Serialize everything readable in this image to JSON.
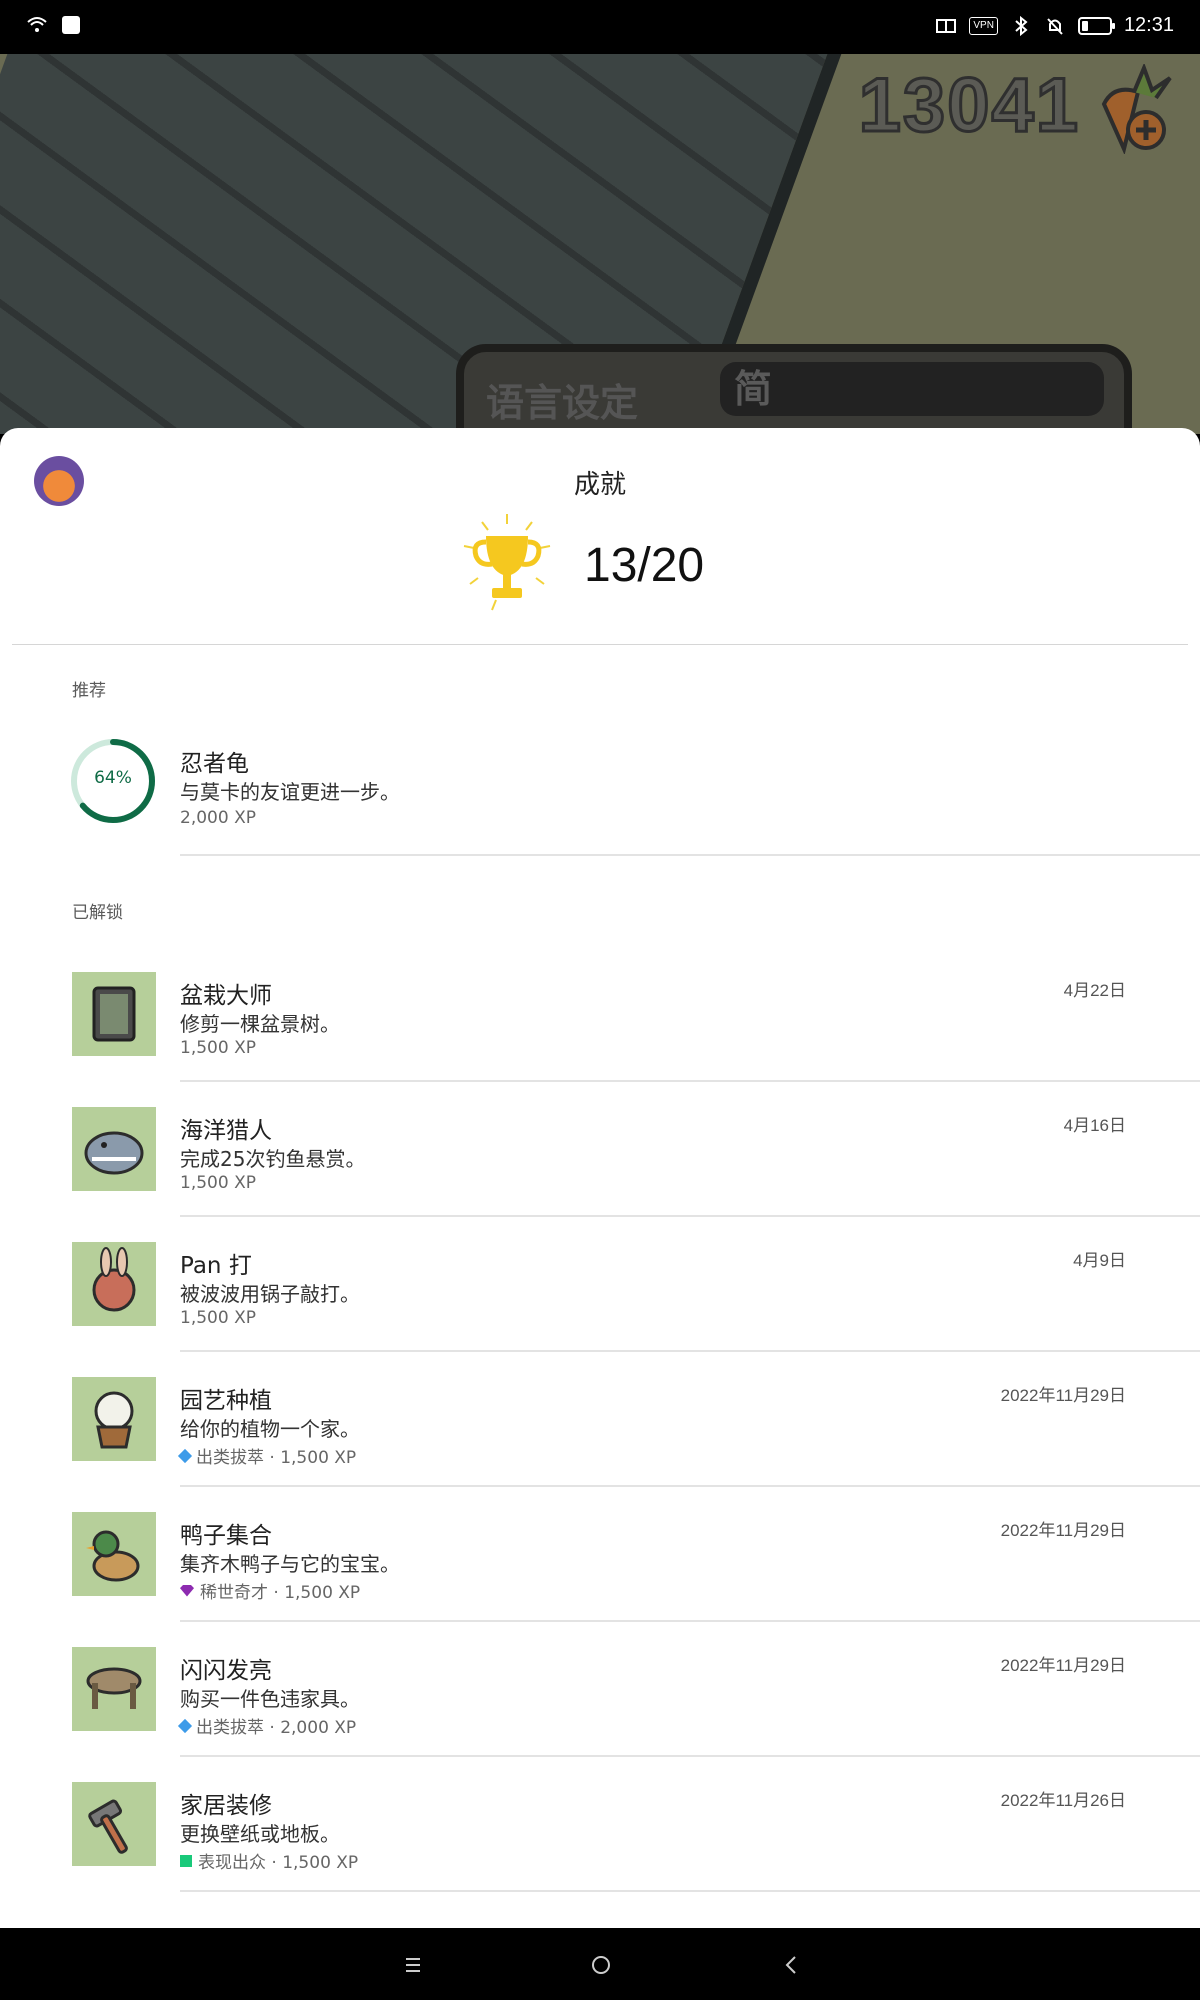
{
  "status_bar": {
    "time": "12:31",
    "vpn": "VPN"
  },
  "game": {
    "carrot_count": "13041",
    "language_label": "语言设定",
    "language_value": "简"
  },
  "sheet": {
    "title": "成就",
    "score": "13/20",
    "recommended_label": "推荐",
    "recommended": {
      "progress_text": "64%",
      "progress": 0.64,
      "title": "忍者龟",
      "desc": "与莫卡的友谊更进一步。",
      "xp": "2,000 XP"
    },
    "unlocked_label": "已解锁",
    "achievements": [
      {
        "title": "盆栽大师",
        "desc": "修剪一棵盆景树。",
        "meta": "1,500 XP",
        "date": "4月22日",
        "rarity": "",
        "icon": "book-icon"
      },
      {
        "title": "海洋猎人",
        "desc": "完成25次钓鱼悬赏。",
        "meta": "1,500 XP",
        "date": "4月16日",
        "rarity": "",
        "icon": "shark-icon"
      },
      {
        "title": "Pan 打",
        "desc": "被波波用锅子敲打。",
        "meta": "1,500 XP",
        "date": "4月9日",
        "rarity": "",
        "icon": "bunny-pan-icon"
      },
      {
        "title": "园艺种植",
        "desc": "给你的植物一个家。",
        "meta": "出类拔萃 · 1,500 XP",
        "date": "2022年11月29日",
        "rarity": "diamond",
        "icon": "flower-pot-icon"
      },
      {
        "title": "鸭子集合",
        "desc": "集齐木鸭子与它的宝宝。",
        "meta": "稀世奇才 · 1,500 XP",
        "date": "2022年11月29日",
        "rarity": "purple",
        "icon": "duck-icon"
      },
      {
        "title": "闪闪发亮",
        "desc": "购买一件色违家具。",
        "meta": "出类拔萃 · 2,000 XP",
        "date": "2022年11月29日",
        "rarity": "diamond",
        "icon": "stool-icon"
      },
      {
        "title": "家居装修",
        "desc": "更换壁纸或地板。",
        "meta": "表现出众 · 1,500 XP",
        "date": "2022年11月26日",
        "rarity": "green",
        "icon": "hammer-icon"
      }
    ]
  },
  "colors": {
    "thumb_bg": "#b6cf9a",
    "progress": "#0f6b46",
    "progress_track": "#cde9dc"
  }
}
